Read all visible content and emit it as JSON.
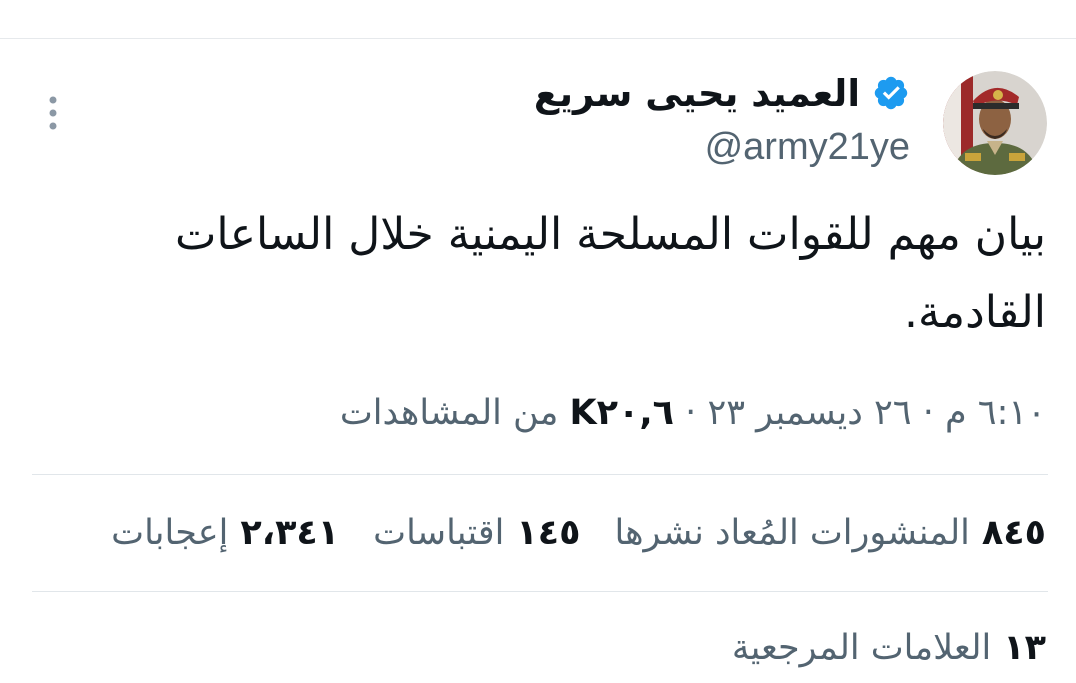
{
  "author": {
    "display_name": "العميد يحيى سريع",
    "handle": "@army21ye",
    "verified": true,
    "avatar": "profile-photo"
  },
  "tweet": {
    "text": "بيان مهم للقوات المسلحة اليمنية خلال الساعات القادمة."
  },
  "meta": {
    "time": "٦:١٠ م",
    "separator": "·",
    "date": "٢٦ ديسمبر ٢٣",
    "views_count": "K٢٠,٦",
    "views_label": "من المشاهدات"
  },
  "stats": {
    "reposts_count": "٨٤٥",
    "reposts_label": "المنشورات المُعاد نشرها",
    "quotes_count": "١٤٥",
    "quotes_label": "اقتباسات",
    "likes_count": "٢،٣٤١",
    "likes_label": "إعجابات",
    "bookmarks_count": "١٣",
    "bookmarks_label": "العلامات المرجعية"
  },
  "colors": {
    "text_primary": "#0f1419",
    "text_secondary": "#536471",
    "verified_blue": "#1d9bf0",
    "divider": "#e1e6ea"
  },
  "icons": [
    "verified-badge-icon",
    "more-options-icon"
  ]
}
